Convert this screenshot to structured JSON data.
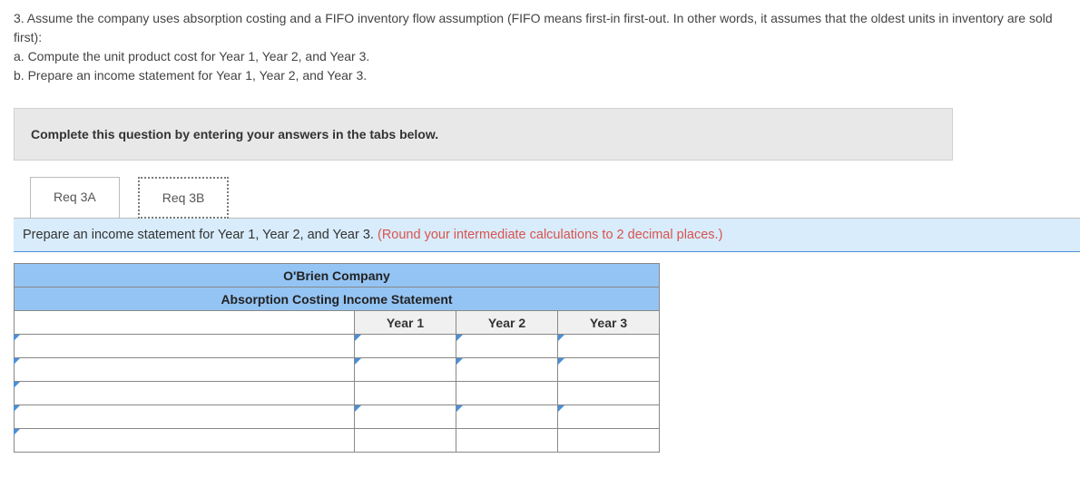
{
  "question": {
    "intro": "3. Assume the company uses absorption costing and a FIFO inventory flow assumption (FIFO means first-in first-out. In other words, it assumes that the oldest units in inventory are sold first):",
    "part_a": "a. Compute the unit product cost for Year 1, Year 2, and Year 3.",
    "part_b": "b. Prepare an income statement for Year 1, Year 2, and Year 3."
  },
  "instruction": "Complete this question by entering your answers in the tabs below.",
  "tabs": {
    "a": "Req 3A",
    "b": "Req 3B"
  },
  "prompt": {
    "main": "Prepare an income statement for Year 1, Year 2, and Year 3. ",
    "highlight": "(Round your intermediate calculations to 2 decimal places.)"
  },
  "table": {
    "company": "O'Brien Company",
    "title": "Absorption Costing Income Statement",
    "cols": {
      "y1": "Year 1",
      "y2": "Year 2",
      "y3": "Year 3"
    }
  }
}
